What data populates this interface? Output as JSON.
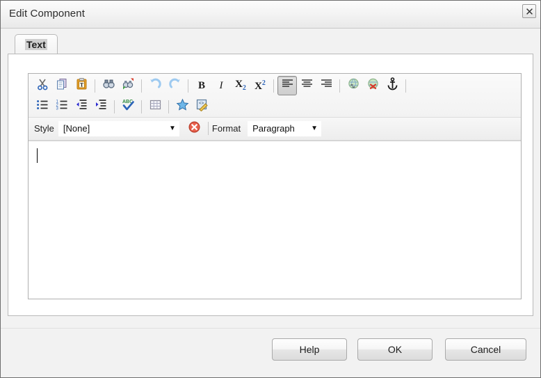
{
  "window": {
    "title": "Edit Component",
    "close_icon": "close-icon"
  },
  "tabs": [
    {
      "label": "Text",
      "selected": true
    }
  ],
  "editor": {
    "toolbar_row1": [
      {
        "name": "cut-icon",
        "title": "Cut"
      },
      {
        "name": "copy-icon",
        "title": "Copy"
      },
      {
        "name": "paste-text-icon",
        "title": "Paste as plain text"
      },
      {
        "name": "separator",
        "title": ""
      },
      {
        "name": "find-icon",
        "title": "Find"
      },
      {
        "name": "replace-icon",
        "title": "Replace"
      },
      {
        "name": "separator",
        "title": ""
      },
      {
        "name": "undo-icon",
        "title": "Undo"
      },
      {
        "name": "redo-icon",
        "title": "Redo"
      },
      {
        "name": "separator",
        "title": ""
      },
      {
        "name": "bold-icon",
        "title": "Bold",
        "glyph": "B"
      },
      {
        "name": "italic-icon",
        "title": "Italic",
        "glyph": "I"
      },
      {
        "name": "subscript-icon",
        "title": "Subscript",
        "glyph": "X"
      },
      {
        "name": "superscript-icon",
        "title": "Superscript",
        "glyph": "X"
      },
      {
        "name": "separator",
        "title": ""
      },
      {
        "name": "align-left-icon",
        "title": "Align Left",
        "pressed": true
      },
      {
        "name": "align-center-icon",
        "title": "Align Center"
      },
      {
        "name": "align-right-icon",
        "title": "Align Right"
      },
      {
        "name": "separator",
        "title": ""
      },
      {
        "name": "link-icon",
        "title": "Link"
      },
      {
        "name": "unlink-icon",
        "title": "Unlink"
      },
      {
        "name": "anchor-icon",
        "title": "Anchor"
      },
      {
        "name": "separator",
        "title": ""
      }
    ],
    "toolbar_row2": [
      {
        "name": "bulleted-list-icon",
        "title": "Insert/Remove Bulleted List"
      },
      {
        "name": "numbered-list-icon",
        "title": "Insert/Remove Numbered List"
      },
      {
        "name": "outdent-icon",
        "title": "Decrease Indent"
      },
      {
        "name": "indent-icon",
        "title": "Increase Indent"
      },
      {
        "name": "separator",
        "title": ""
      },
      {
        "name": "spellcheck-icon",
        "title": "Check Spelling"
      },
      {
        "name": "separator",
        "title": ""
      },
      {
        "name": "table-icon",
        "title": "Table"
      },
      {
        "name": "separator",
        "title": ""
      },
      {
        "name": "star-icon",
        "title": "Insert Special Item"
      },
      {
        "name": "source-edit-icon",
        "title": "Edit Source"
      }
    ],
    "style_label": "Style",
    "style_value": "[None]",
    "remove_format_icon": "remove-format-icon",
    "format_label": "Format",
    "format_value": "Paragraph",
    "content": "",
    "caret_visible": true
  },
  "footer": {
    "help_label": "Help",
    "ok_label": "OK",
    "cancel_label": "Cancel"
  },
  "colors": {
    "dialog_bg": "#f1f1f1",
    "panel_bg": "#ffffff",
    "toolbar_bg": "#eeeeee",
    "border": "#b9b9b9",
    "accent_blue": "#2b63b8",
    "remove_format_red": "#e04b3a"
  }
}
